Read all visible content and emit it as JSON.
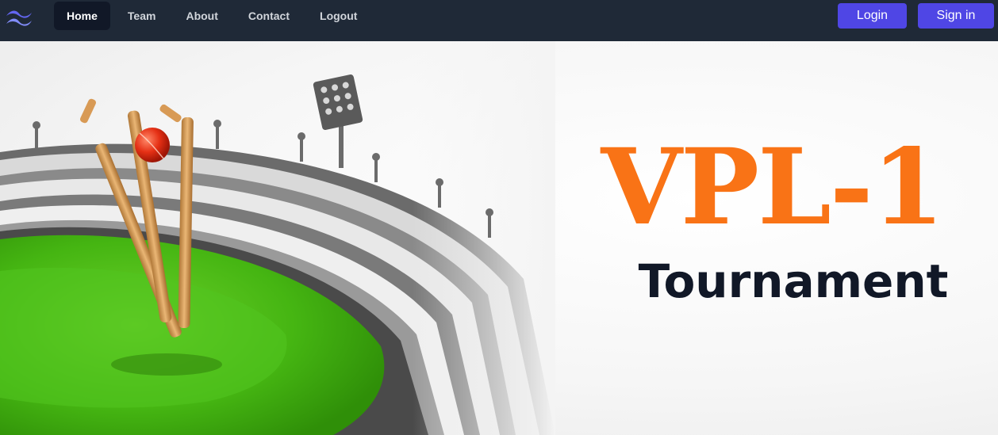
{
  "nav": {
    "logo_icon": "tailwind-waves-icon",
    "items": [
      {
        "label": "Home",
        "active": true
      },
      {
        "label": "Team",
        "active": false
      },
      {
        "label": "About",
        "active": false
      },
      {
        "label": "Contact",
        "active": false
      },
      {
        "label": "Logout",
        "active": false
      }
    ],
    "login_label": "Login",
    "signin_label": "Sign in"
  },
  "hero": {
    "title": "VPL-1",
    "subtitle": "Tournament",
    "image_icon": "cricket-stadium-stumps-illustration"
  },
  "colors": {
    "navbar_bg": "#1f2937",
    "active_nav_bg": "#111827",
    "button_accent": "#4f46e5",
    "title_orange": "#f97316",
    "subtitle_dark": "#111827",
    "field_green": "#4caf1a"
  }
}
